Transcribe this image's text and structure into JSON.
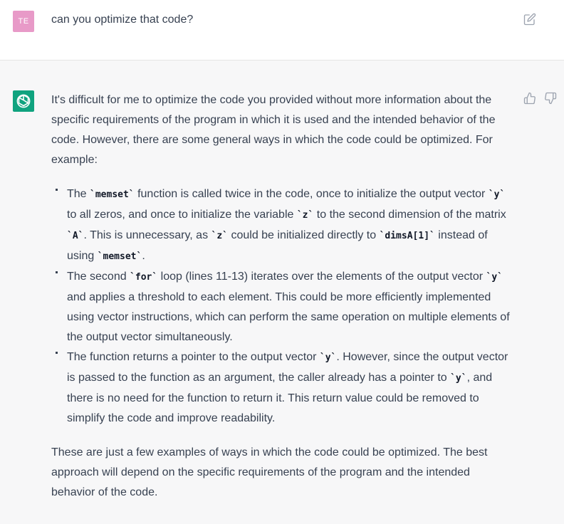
{
  "user_message": {
    "avatar_initials": "TE",
    "avatar_color": "#e89ac8",
    "text": "can you optimize that code?",
    "edit_icon": "edit-icon"
  },
  "assistant_message": {
    "avatar_icon": "openai-logo-icon",
    "avatar_color": "#10a37f",
    "feedback_icons": [
      "thumbs-up-icon",
      "thumbs-down-icon"
    ],
    "intro": "It's difficult for me to optimize the code you provided without more information about the specific requirements of the program in which it is used and the intended behavior of the code. However, there are some general ways in which the code could be optimized. For example:",
    "bullets": [
      {
        "t1": "The ",
        "c1": "`memset`",
        "t2": " function is called twice in the code, once to initialize the output vector ",
        "c2": "`y`",
        "t3": " to all zeros, and once to initialize the variable ",
        "c3": "`z`",
        "t4": " to the second dimension of the matrix ",
        "c4": "`A`",
        "t5": ". This is unnecessary, as ",
        "c5": "`z`",
        "t6": " could be initialized directly to ",
        "c6": "`dimsA[1]`",
        "t7": " instead of using ",
        "c7": "`memset`",
        "t8": "."
      },
      {
        "t1": "The second ",
        "c1": "`for`",
        "t2": " loop (lines 11-13) iterates over the elements of the output vector ",
        "c2": "`y`",
        "t3": " and applies a threshold to each element. This could be more efficiently implemented using vector instructions, which can perform the same operation on multiple elements of the output vector simultaneously."
      },
      {
        "t1": "The function returns a pointer to the output vector ",
        "c1": "`y`",
        "t2": ". However, since the output vector is passed to the function as an argument, the caller already has a pointer to ",
        "c2": "`y`",
        "t3": ", and there is no need for the function to return it. This return value could be removed to simplify the code and improve readability."
      }
    ],
    "outro": "These are just a few examples of ways in which the code could be optimized. The best approach will depend on the specific requirements of the program and the intended behavior of the code."
  }
}
